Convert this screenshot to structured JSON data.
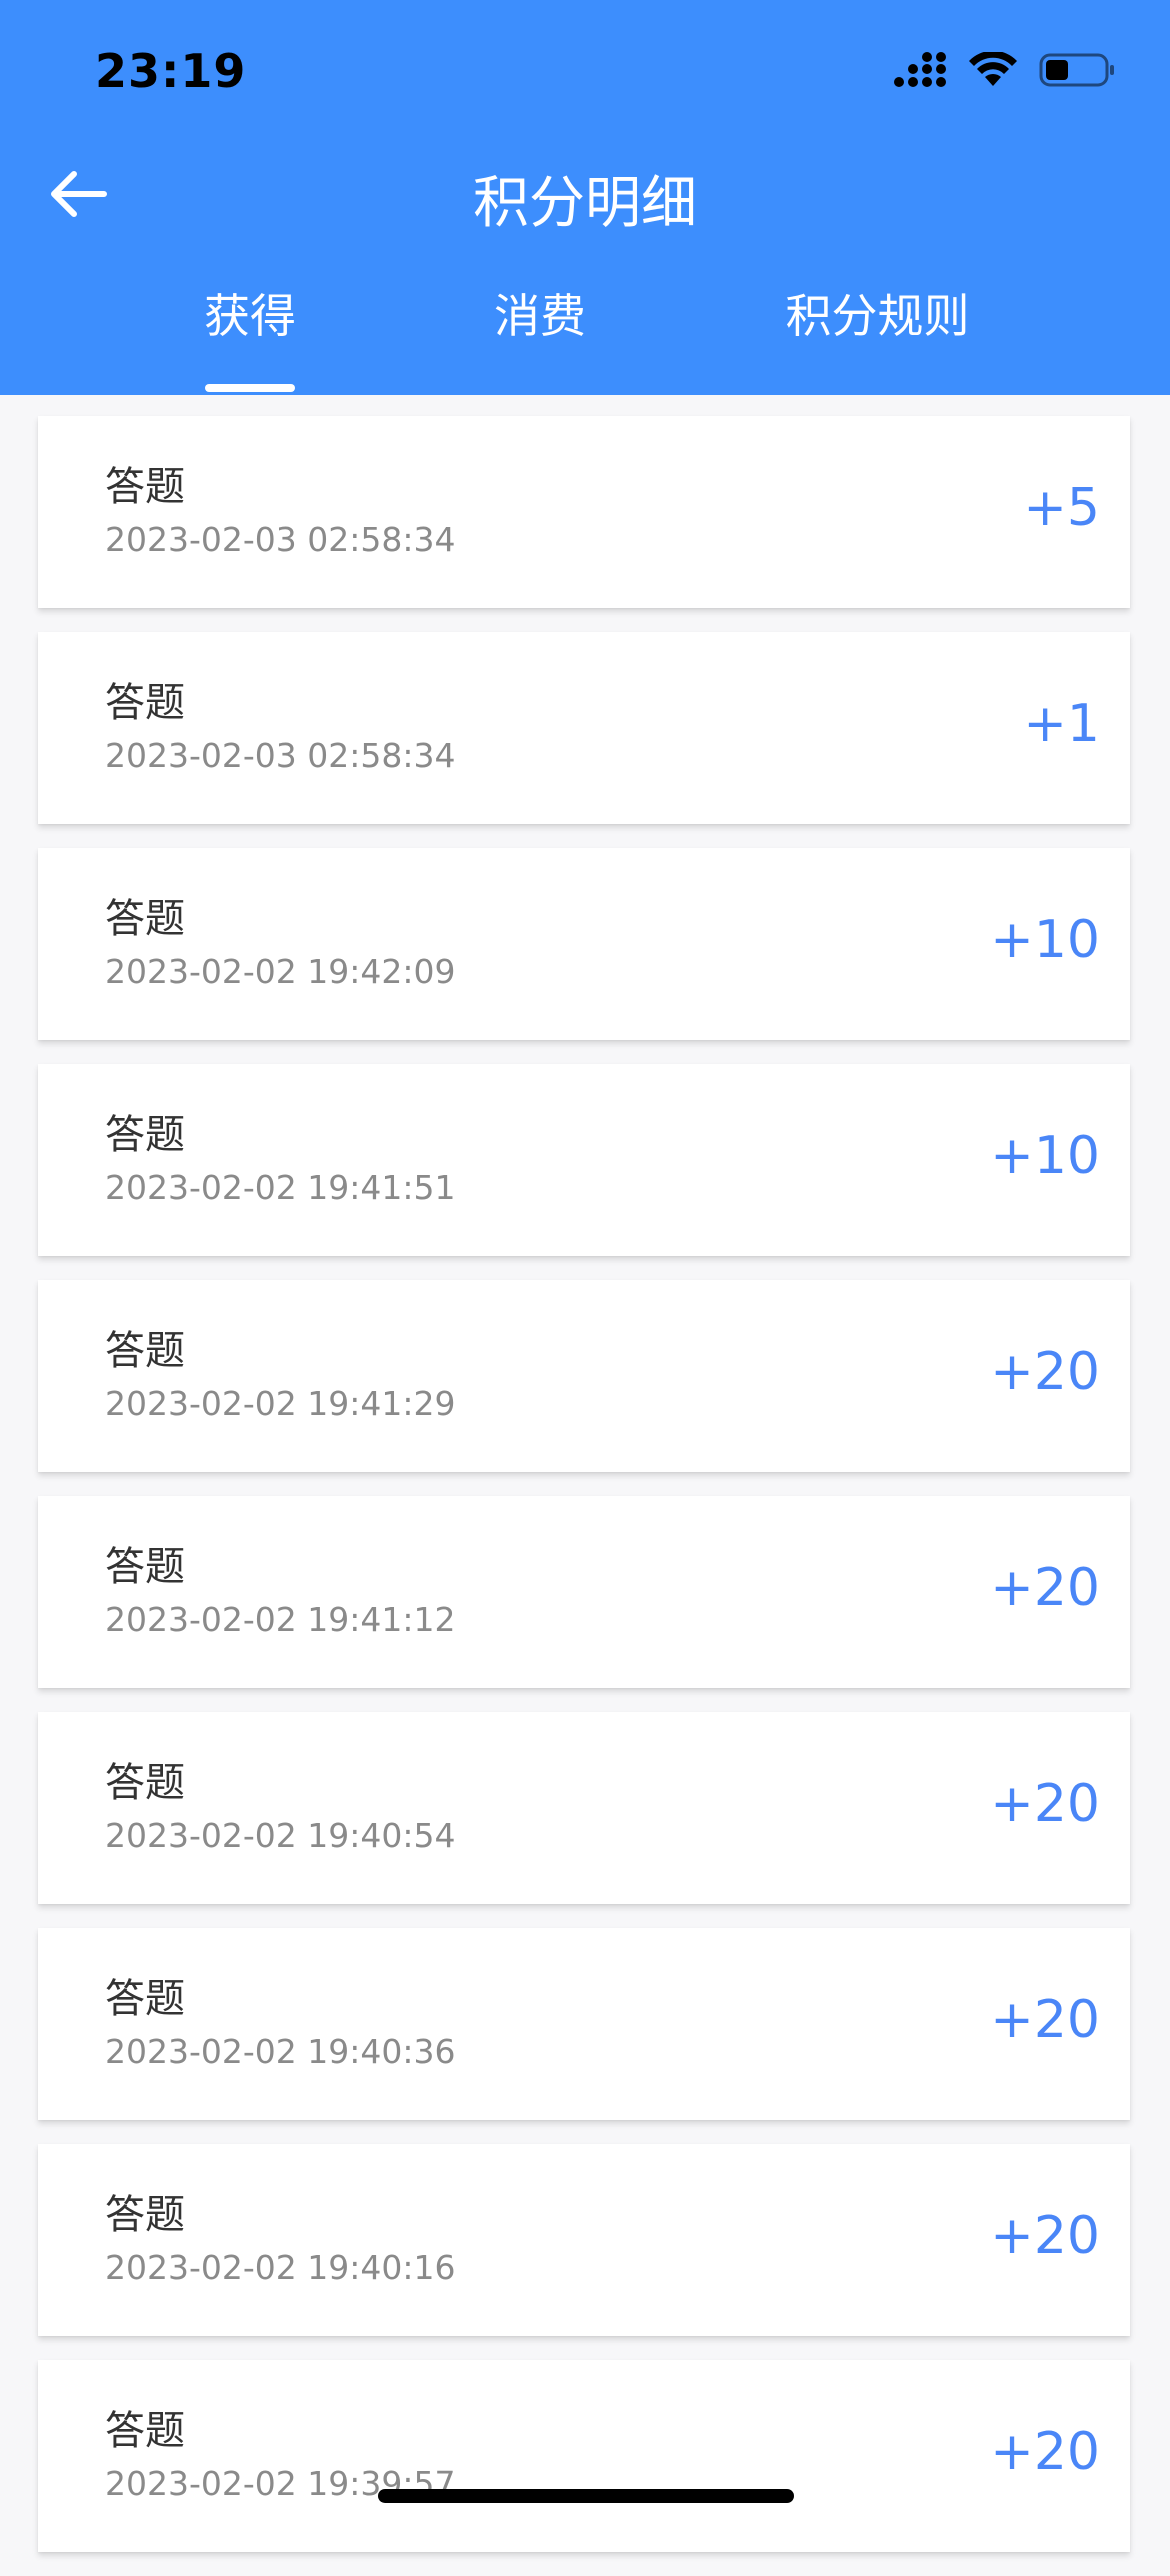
{
  "status_bar": {
    "time": "23:19"
  },
  "header": {
    "title": "积分明细",
    "back_icon": "arrow-left-icon"
  },
  "tabs": [
    {
      "label": "获得",
      "active": true
    },
    {
      "label": "消费",
      "active": false
    },
    {
      "label": "积分规则",
      "active": false
    }
  ],
  "records": [
    {
      "title": "答题",
      "time": "2023-02-03 02:58:34",
      "points": "+5"
    },
    {
      "title": "答题",
      "time": "2023-02-03 02:58:34",
      "points": "+1"
    },
    {
      "title": "答题",
      "time": "2023-02-02 19:42:09",
      "points": "+10"
    },
    {
      "title": "答题",
      "time": "2023-02-02 19:41:51",
      "points": "+10"
    },
    {
      "title": "答题",
      "time": "2023-02-02 19:41:29",
      "points": "+20"
    },
    {
      "title": "答题",
      "time": "2023-02-02 19:41:12",
      "points": "+20"
    },
    {
      "title": "答题",
      "time": "2023-02-02 19:40:54",
      "points": "+20"
    },
    {
      "title": "答题",
      "time": "2023-02-02 19:40:36",
      "points": "+20"
    },
    {
      "title": "答题",
      "time": "2023-02-02 19:40:16",
      "points": "+20"
    },
    {
      "title": "答题",
      "time": "2023-02-02 19:39:57",
      "points": "+20"
    }
  ],
  "colors": {
    "header_bg": "#3d8efd",
    "points": "#4a86f7",
    "page_bg": "#f7f7f9"
  }
}
